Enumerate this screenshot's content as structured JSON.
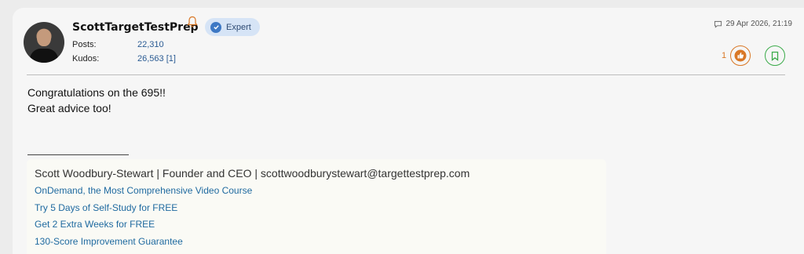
{
  "post": {
    "author": {
      "username": "ScottTargetTestPrep",
      "badge": "Expert",
      "stats": [
        {
          "label": "Posts:",
          "value": "22,310"
        },
        {
          "label": "Kudos:",
          "value": "26,563",
          "sub": "[1]"
        }
      ]
    },
    "timestamp": "29 Apr 2026, 21:19",
    "kudos_count": "1",
    "body_lines": [
      "Congratulations on the 695!!",
      "Great advice too!"
    ],
    "signature": {
      "name_line": "Scott Woodbury-Stewart | Founder and CEO | scottwoodburystewart@targettestprep.com",
      "links": [
        "OnDemand, the Most Comprehensive Video Course",
        "Try 5 Days of Self-Study for FREE",
        "Get 2 Extra Weeks for FREE",
        "130-Score Improvement Guarantee"
      ]
    },
    "colors": {
      "kudos_accent": "#d97726",
      "bookmark_accent": "#3bab4a",
      "link": "#1f6aa0",
      "badge_bg": "#d6e4f6"
    }
  }
}
